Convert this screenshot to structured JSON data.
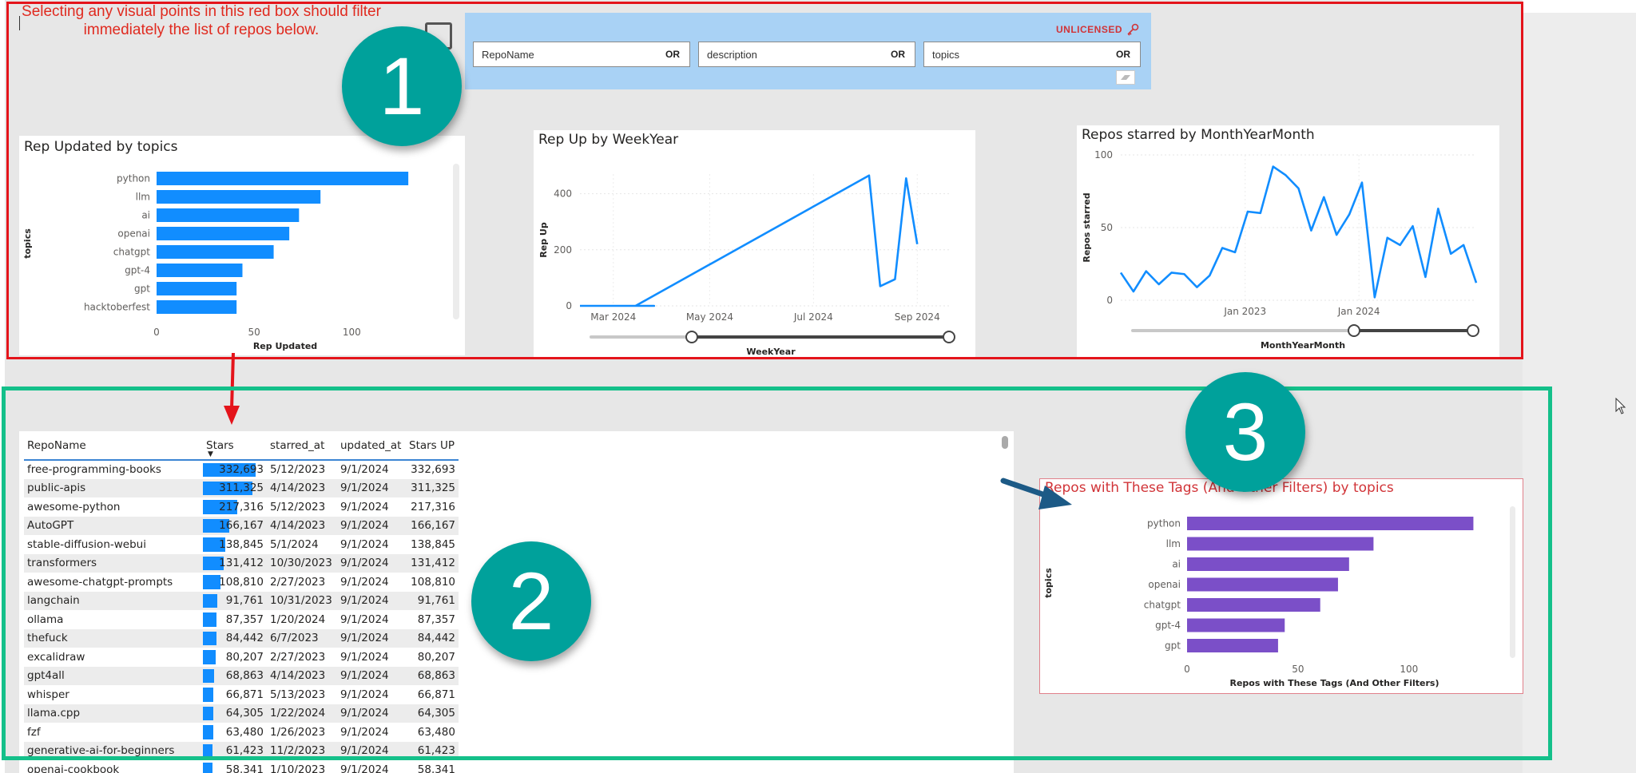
{
  "note": {
    "line1": "Selecting any visual points in this red box should filter",
    "line2": "immediately the list of repos below."
  },
  "callouts": {
    "one": "1",
    "two": "2",
    "three": "3"
  },
  "filters": {
    "license": "UNLICENSED",
    "fields": [
      {
        "label": "RepoName",
        "op": "OR"
      },
      {
        "label": "description",
        "op": "OR"
      },
      {
        "label": "topics",
        "op": "OR"
      }
    ]
  },
  "rep_updated_title": "Rep Updated by topics",
  "rep_up_title": "Rep Up by WeekYear",
  "starred_title": "Repos starred by MonthYearMonth",
  "tags_title": "Repos with These Tags (And Other Filters) by topics",
  "chart_data": [
    {
      "type": "bar",
      "orientation": "horizontal",
      "title": "Rep Updated by topics",
      "xlabel": "Rep Updated",
      "ylabel": "topics",
      "categories": [
        "python",
        "llm",
        "ai",
        "openai",
        "chatgpt",
        "gpt-4",
        "gpt",
        "hacktoberfest"
      ],
      "values": [
        129,
        84,
        73,
        68,
        60,
        44,
        41,
        41
      ],
      "xticks": [
        "0",
        "50",
        "100"
      ],
      "xlim": [
        0,
        140
      ],
      "color": "#118dff"
    },
    {
      "type": "line",
      "title": "Rep Up by WeekYear",
      "xlabel": "WeekYear",
      "ylabel": "Rep Up",
      "xticks": [
        "Mar 2024",
        "May 2024",
        "Jul 2024",
        "Sep 2024"
      ],
      "yticks": [
        "0",
        "200",
        "400"
      ],
      "ylim": [
        0,
        470
      ],
      "x": [
        "2024-02-25",
        "2024-03-03",
        "2024-03-10",
        "2024-03-17",
        "2024-03-24",
        "2024-03-31",
        "2024-08-04",
        "2024-08-11",
        "2024-08-18",
        "2024-08-25",
        "2024-09-01"
      ],
      "values": [
        0,
        0,
        0,
        0,
        0,
        0,
        465,
        70,
        95,
        455,
        220
      ],
      "color": "#118dff"
    },
    {
      "type": "line",
      "title": "Repos starred by MonthYearMonth",
      "xlabel": "MonthYearMonth",
      "ylabel": "Repos starred",
      "xticks": [
        "Jan 2023",
        "Jan 2024"
      ],
      "yticks": [
        "0",
        "50",
        "100"
      ],
      "ylim": [
        0,
        100
      ],
      "x": [
        "2022-02",
        "2022-03",
        "2022-04",
        "2022-05",
        "2022-06",
        "2022-07",
        "2022-08",
        "2022-09",
        "2022-10",
        "2022-11",
        "2022-12",
        "2023-01",
        "2023-02",
        "2023-03",
        "2023-04",
        "2023-05",
        "2023-06",
        "2023-07",
        "2023-08",
        "2023-09",
        "2023-10",
        "2023-11",
        "2023-12",
        "2024-01",
        "2024-02",
        "2024-03",
        "2024-04",
        "2024-05",
        "2024-06",
        "2024-07",
        "2024-08",
        "2024-09"
      ],
      "values": [
        19,
        6,
        20,
        11,
        19,
        18,
        9,
        17,
        36,
        33,
        61,
        60,
        92,
        86,
        77,
        48,
        71,
        45,
        59,
        81,
        2,
        43,
        38,
        51,
        16,
        63,
        32,
        38,
        12
      ],
      "color": "#118dff"
    },
    {
      "type": "bar",
      "orientation": "horizontal",
      "title": "Repos with These Tags (And Other Filters) by topics",
      "xlabel": "Repos with These Tags (And Other Filters)",
      "ylabel": "topics",
      "categories": [
        "python",
        "llm",
        "ai",
        "openai",
        "chatgpt",
        "gpt-4",
        "gpt"
      ],
      "values": [
        129,
        84,
        73,
        68,
        60,
        44,
        41
      ],
      "xticks": [
        "0",
        "50",
        "100"
      ],
      "xlim": [
        0,
        140
      ],
      "color": "#7b4fc8"
    }
  ],
  "table": {
    "headers": [
      "RepoName",
      "Stars",
      "starred_at",
      "updated_at",
      "Stars UP"
    ],
    "rows": [
      [
        "free-programming-books",
        "332,693",
        "5/12/2023",
        "9/1/2024",
        "332,693"
      ],
      [
        "public-apis",
        "311,325",
        "4/14/2023",
        "9/1/2024",
        "311,325"
      ],
      [
        "awesome-python",
        "217,316",
        "5/12/2023",
        "9/1/2024",
        "217,316"
      ],
      [
        "AutoGPT",
        "166,167",
        "4/14/2023",
        "9/1/2024",
        "166,167"
      ],
      [
        "stable-diffusion-webui",
        "138,845",
        "5/1/2024",
        "9/1/2024",
        "138,845"
      ],
      [
        "transformers",
        "131,412",
        "10/30/2023",
        "9/1/2024",
        "131,412"
      ],
      [
        "awesome-chatgpt-prompts",
        "108,810",
        "2/27/2023",
        "9/1/2024",
        "108,810"
      ],
      [
        "langchain",
        "91,761",
        "10/31/2023",
        "9/1/2024",
        "91,761"
      ],
      [
        "ollama",
        "87,357",
        "1/20/2024",
        "9/1/2024",
        "87,357"
      ],
      [
        "thefuck",
        "84,442",
        "6/7/2023",
        "9/1/2024",
        "84,442"
      ],
      [
        "excalidraw",
        "80,207",
        "2/27/2023",
        "9/1/2024",
        "80,207"
      ],
      [
        "gpt4all",
        "68,863",
        "4/14/2023",
        "9/1/2024",
        "68,863"
      ],
      [
        "whisper",
        "66,871",
        "5/13/2023",
        "9/1/2024",
        "66,871"
      ],
      [
        "llama.cpp",
        "64,305",
        "1/22/2024",
        "9/1/2024",
        "64,305"
      ],
      [
        "fzf",
        "63,480",
        "1/26/2023",
        "9/1/2024",
        "63,480"
      ],
      [
        "generative-ai-for-beginners",
        "61,423",
        "11/2/2023",
        "9/1/2024",
        "61,423"
      ],
      [
        "openai-cookbook",
        "58,341",
        "1/10/2023",
        "9/1/2024",
        "58,341"
      ]
    ],
    "stars_values": [
      332693,
      311325,
      217316,
      166167,
      138845,
      131412,
      108810,
      91761,
      87357,
      84442,
      80207,
      68863,
      66871,
      64305,
      63480,
      61423,
      58341
    ]
  }
}
